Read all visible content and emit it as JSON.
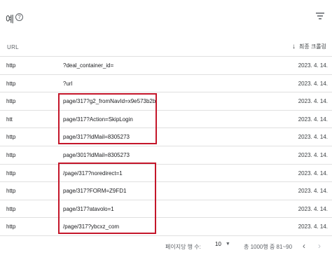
{
  "header": {
    "title": "예",
    "help_icon": "help-circle-icon",
    "filter_icon": "filter-icon"
  },
  "table": {
    "col_url": "URL",
    "col_date": "최종 크롤링",
    "sort_icon": "arrow-down-icon",
    "rows": [
      {
        "prefix": "http",
        "path": "?deal_container_id=",
        "date": "2023. 4. 14."
      },
      {
        "prefix": "http",
        "path": "?url",
        "date": "2023. 4. 14."
      },
      {
        "prefix": "http",
        "path": "page/317?g2_fromNavId=x9e573b2b",
        "date": "2023. 4. 14."
      },
      {
        "prefix": "htt",
        "path": "page/317?Action=SkipLogin",
        "date": "2023. 4. 14."
      },
      {
        "prefix": "http",
        "path": "page/317?IdMail=8305273",
        "date": "2023. 4. 14."
      },
      {
        "prefix": "http",
        "path": "page/301?IdMail=8305273",
        "date": "2023. 4. 14."
      },
      {
        "prefix": "http",
        "path": "/page/317?noredirect=1",
        "date": "2023. 4. 14."
      },
      {
        "prefix": "http",
        "path": "page/317?FORM=Z9FD1",
        "date": "2023. 4. 14."
      },
      {
        "prefix": "http",
        "path": "page/317?atavolo=1",
        "date": "2023. 4. 14."
      },
      {
        "prefix": "http",
        "path": "/page/317?ybcxz_com",
        "date": "2023. 4. 14."
      }
    ]
  },
  "footer": {
    "rows_per_page_label": "페이지당 행 수:",
    "rows_per_page_value": "10",
    "pager_info": "총 1000행 중 81~90",
    "prev_icon": "chevron-left-icon",
    "next_icon": "chevron-right-icon"
  }
}
